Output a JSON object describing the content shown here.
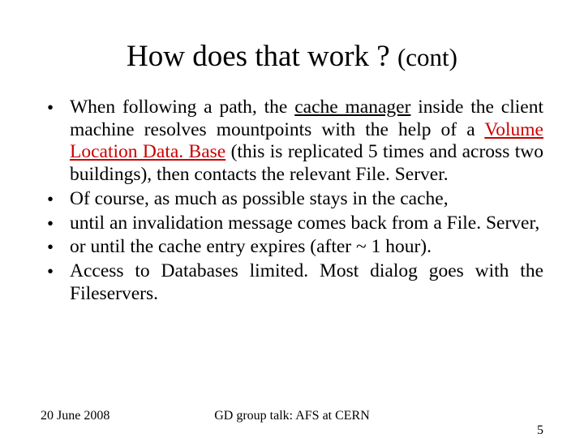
{
  "title": {
    "main": "How does that work ? ",
    "sub": "(cont)"
  },
  "bullets": [
    {
      "t1": "When following a path, the ",
      "cache_manager": "cache manager",
      "t2": " inside the client machine resolves mountpoints with the help of a ",
      "vldb": "Volume Location Data. Base",
      "t3": " (this is replicated 5 times and across two buildings),  then contacts the relevant File. Server."
    },
    {
      "text": "Of course, as much as possible stays in the cache,"
    },
    {
      "text": "until an invalidation message comes back from a File. Server,"
    },
    {
      "text": "or until the cache entry expires (after ~ 1 hour)."
    },
    {
      "text": "Access to Databases limited. Most dialog goes with the Fileservers."
    }
  ],
  "footer": {
    "date": "20 June 2008",
    "center": "GD group talk: AFS at CERN",
    "page": "5"
  }
}
